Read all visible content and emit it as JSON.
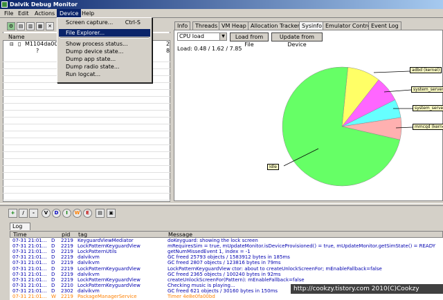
{
  "window": {
    "title": "Dalvik Debug Monitor"
  },
  "menubar": [
    "File",
    "Edit",
    "Actions",
    "Device",
    "Help"
  ],
  "device_menu": {
    "items": [
      {
        "label": "Screen capture...",
        "shortcut": "Ctrl-S"
      },
      {
        "label": "File Explorer...",
        "shortcut": ""
      },
      {
        "label": "Show process status...",
        "shortcut": ""
      },
      {
        "label": "Dump device state...",
        "shortcut": ""
      },
      {
        "label": "Dump app state...",
        "shortcut": ""
      },
      {
        "label": "Dump radio state...",
        "shortcut": ""
      },
      {
        "label": "Run logcat...",
        "shortcut": ""
      }
    ]
  },
  "device_panel": {
    "col_name": "Name",
    "device_name": "M1104da002t",
    "device_marker": "?",
    "right_cells": [
      "2",
      "8"
    ]
  },
  "tabs": [
    "Info",
    "Threads",
    "VM Heap",
    "Allocation Tracker",
    "Sysinfo",
    "Emulator Control",
    "Event Log"
  ],
  "sysinfo": {
    "select_value": "CPU load",
    "load_from_file": "Load from File",
    "update_from_device": "Update from Device",
    "load_text": "Load: 0.48 / 1.62 / 7.85"
  },
  "chart_data": {
    "type": "pie",
    "slices": [
      {
        "label": "adbd (kernel)",
        "value": 9,
        "color": "#ffff66"
      },
      {
        "label": "system_server (",
        "value": 7,
        "color": "#ff66ff"
      },
      {
        "label": "system_server (",
        "value": 5,
        "color": "#66ffff"
      },
      {
        "label": "mmcqd (kernel)",
        "value": 6,
        "color": "#ffb0b0"
      },
      {
        "label": "Idle",
        "value": 73,
        "color": "#66ff66"
      }
    ]
  },
  "log_toolbar": {
    "icons": [
      "+",
      "/",
      "-"
    ],
    "levels": [
      "V",
      "D",
      "I",
      "W",
      "E"
    ]
  },
  "log": {
    "tab": "Log",
    "headers": {
      "time": "Time",
      "pid": "pid",
      "tag": "tag",
      "message": "Message"
    },
    "rows": [
      {
        "time": "07-31 21:01...",
        "lvl": "D",
        "pid": "2219",
        "tag": "KeyguardViewMediator",
        "msg": "doKeyguard: showing the lock screen"
      },
      {
        "time": "07-31 21:01...",
        "lvl": "D",
        "pid": "2219",
        "tag": "LockPatternKeyguardView",
        "msg": "mRequiresSim = true, mUpdateMonitor.isDeviceProvisioned() = true, mUpdateMonitor.getSimState() = READY"
      },
      {
        "time": "07-31 21:01...",
        "lvl": "D",
        "pid": "2219",
        "tag": "LockPatternUtils",
        "msg": "getNumMissedEvent 1, index = -1"
      },
      {
        "time": "07-31 21:01...",
        "lvl": "D",
        "pid": "2219",
        "tag": "dalvikvm",
        "msg": "GC freed 25793 objects / 1583912 bytes in 185ms"
      },
      {
        "time": "07-31 21:01...",
        "lvl": "D",
        "pid": "2219",
        "tag": "dalvikvm",
        "msg": "GC freed 2807 objects / 123816 bytes in 79ms"
      },
      {
        "time": "07-31 21:01...",
        "lvl": "D",
        "pid": "2219",
        "tag": "LockPatternKeyguardView",
        "msg": "LockPatternKeyguardView ctor: about to createUnlockScreenFor; mEnableFallback=false"
      },
      {
        "time": "07-31 21:01...",
        "lvl": "D",
        "pid": "2219",
        "tag": "dalvikvm",
        "msg": "GC freed 2365 objects / 100240 bytes in 92ms"
      },
      {
        "time": "07-31 21:01...",
        "lvl": "D",
        "pid": "2219",
        "tag": "LockPatternKeyguardView",
        "msg": "createUnlockScreenFor(Pattern): mEnableFallback=false"
      },
      {
        "time": "07-31 21:01...",
        "lvl": "D",
        "pid": "2210",
        "tag": "LockPatternKeyguardView",
        "msg": "Checking music is playing..."
      },
      {
        "time": "07-31 21:01...",
        "lvl": "D",
        "pid": "2302",
        "tag": "dalvikvm",
        "msg": "GC freed 621 objects / 30160 bytes in 150ms"
      },
      {
        "time": "07-31 21:01...",
        "lvl": "W",
        "pid": "2219",
        "tag": "PackageManagerService",
        "msg": "Timer 4e8e0fa00bd"
      }
    ]
  },
  "watermark": "http://cookzy.tistory.com 2010(C)Cookzy"
}
